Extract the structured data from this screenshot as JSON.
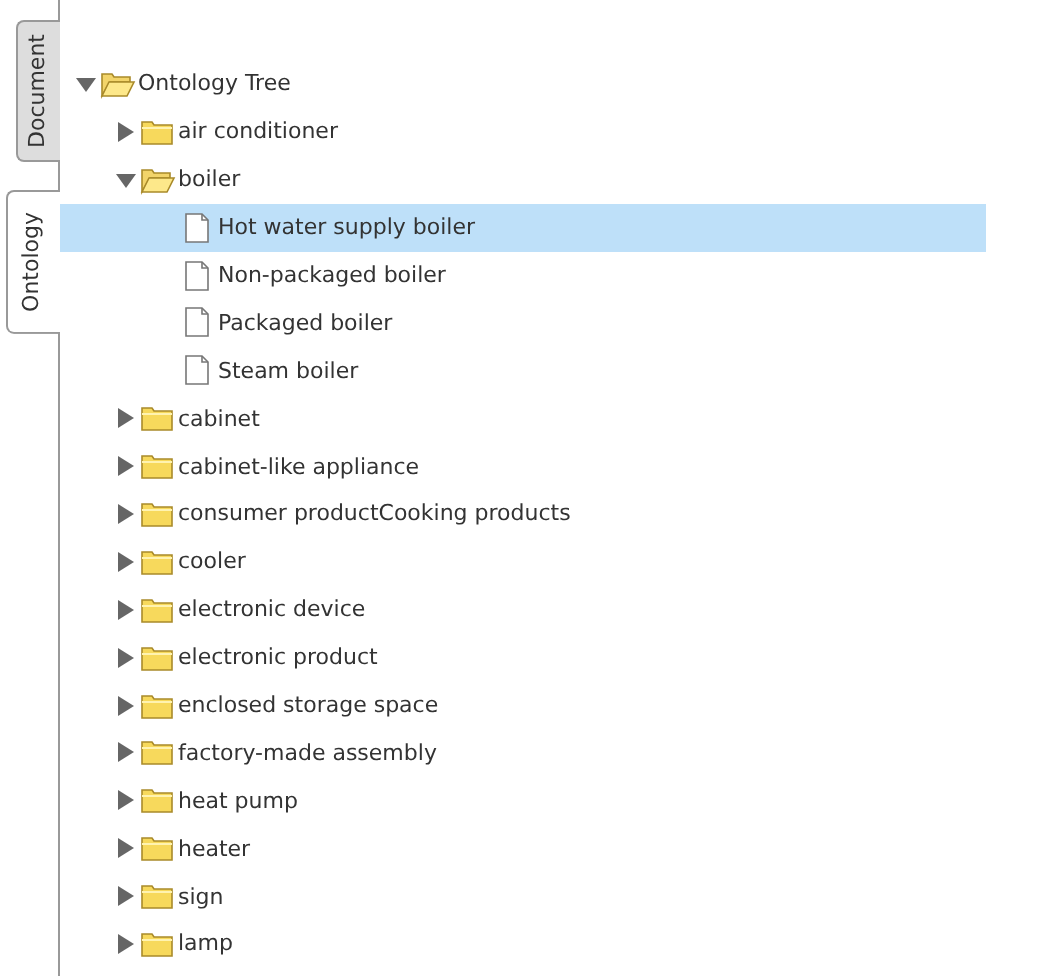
{
  "side_tabs": [
    {
      "label": "Document",
      "selected": false
    },
    {
      "label": "Ontology",
      "selected": true
    }
  ],
  "tree": [
    {
      "label": "Ontology Tree",
      "kind": "folder",
      "expanded": true,
      "selected": false,
      "children": [
        {
          "label": "air conditioner",
          "kind": "folder",
          "expanded": false,
          "selected": false
        },
        {
          "label": "boiler",
          "kind": "folder",
          "expanded": true,
          "selected": false,
          "children": [
            {
              "label": "Hot water supply boiler",
              "kind": "file",
              "selected": true
            },
            {
              "label": "Non-packaged boiler",
              "kind": "file",
              "selected": false
            },
            {
              "label": "Packaged boiler",
              "kind": "file",
              "selected": false
            },
            {
              "label": "Steam boiler",
              "kind": "file",
              "selected": false
            }
          ]
        },
        {
          "label": "cabinet",
          "kind": "folder",
          "expanded": false,
          "selected": false
        },
        {
          "label": "cabinet-like appliance",
          "kind": "folder",
          "expanded": false,
          "selected": false
        },
        {
          "label": "consumer productCooking products",
          "kind": "folder",
          "expanded": false,
          "selected": false
        },
        {
          "label": "cooler",
          "kind": "folder",
          "expanded": false,
          "selected": false
        },
        {
          "label": "electronic device",
          "kind": "folder",
          "expanded": false,
          "selected": false
        },
        {
          "label": "electronic product",
          "kind": "folder",
          "expanded": false,
          "selected": false
        },
        {
          "label": "enclosed storage space",
          "kind": "folder",
          "expanded": false,
          "selected": false
        },
        {
          "label": "factory-made assembly",
          "kind": "folder",
          "expanded": false,
          "selected": false
        },
        {
          "label": "heat pump",
          "kind": "folder",
          "expanded": false,
          "selected": false
        },
        {
          "label": "heater",
          "kind": "folder",
          "expanded": false,
          "selected": false
        },
        {
          "label": "sign",
          "kind": "folder",
          "expanded": false,
          "selected": false
        },
        {
          "label": "lamp",
          "kind": "folder",
          "expanded": false,
          "selected": false
        }
      ]
    }
  ]
}
